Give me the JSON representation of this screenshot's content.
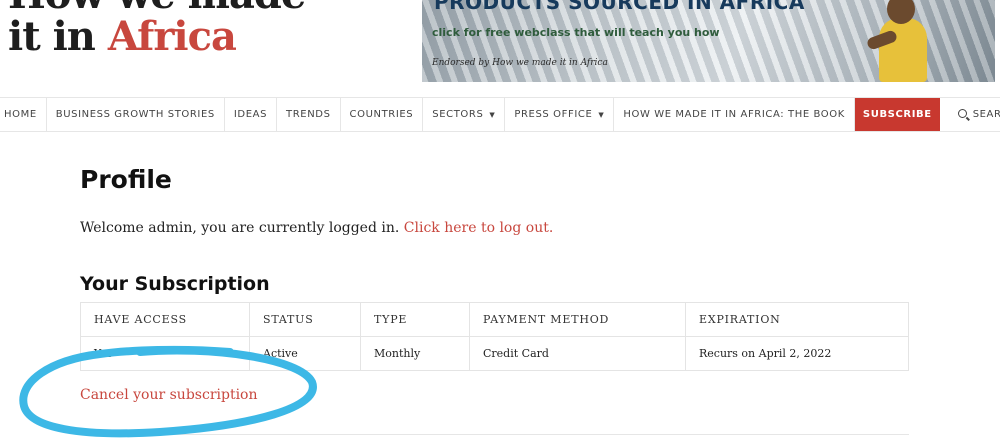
{
  "logo": {
    "line1": "How we made",
    "line2_prefix": "it in ",
    "line2_accent": "Africa"
  },
  "banner": {
    "headline": "PRODUCTS SOURCED IN AFRICA",
    "sub": "click for free webclass that will teach you how",
    "endorsed": "Endorsed by How we made it in Africa"
  },
  "nav": {
    "items": [
      "HOME",
      "BUSINESS GROWTH STORIES",
      "IDEAS",
      "TRENDS",
      "COUNTRIES",
      "SECTORS",
      "PRESS OFFICE",
      "HOW WE MADE IT IN AFRICA: THE BOOK"
    ],
    "caret": "▼",
    "subscribe": "SUBSCRIBE",
    "search": "SEARCH"
  },
  "colors": {
    "accent": "#c8473e",
    "subscribe_bg": "#c8382f",
    "annotation": "#3db8e6"
  },
  "profile": {
    "title": "Profile",
    "welcome_text": "Welcome admin, you are currently logged in. ",
    "logout_link": "Click here to log out."
  },
  "subscription": {
    "heading": "Your Subscription",
    "columns": [
      "HAVE ACCESS",
      "STATUS",
      "TYPE",
      "PAYMENT METHOD",
      "EXPIRATION"
    ],
    "row": [
      "Yes",
      "Active",
      "Monthly",
      "Credit Card",
      "Recurs on April 2, 2022"
    ],
    "cancel_link": "Cancel your subscription"
  }
}
